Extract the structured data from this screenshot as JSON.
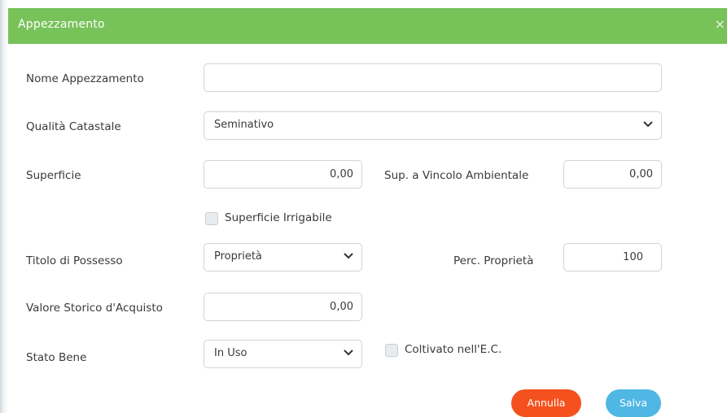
{
  "modal": {
    "title": "Appezzamento",
    "close_icon": "×"
  },
  "fields": {
    "nome_label": "Nome Appezzamento",
    "nome_value": "",
    "qualita_label": "Qualità Catastale",
    "qualita_value": "Seminativo",
    "superficie_label": "Superficie",
    "superficie_value": "0,00",
    "sup_vincolo_label": "Sup. a Vincolo Ambientale",
    "sup_vincolo_value": "0,00",
    "irrigabile_label": "Superficie Irrigabile",
    "titolo_label": "Titolo di Possesso",
    "titolo_value": "Proprietà",
    "perc_label": "Perc. Proprietà",
    "perc_value": "100",
    "valore_label": "Valore Storico d'Acquisto",
    "valore_value": "0,00",
    "stato_label": "Stato Bene",
    "stato_value": "In Uso",
    "coltivato_label": "Coltivato nell'E.C."
  },
  "buttons": {
    "cancel": "Annulla",
    "save": "Salva"
  },
  "colors": {
    "header": "#78c25a",
    "cancel": "#f4511e",
    "save": "#4fb7e3"
  },
  "icons": {
    "dropdown": "chevron-down-icon",
    "close": "close-icon"
  }
}
